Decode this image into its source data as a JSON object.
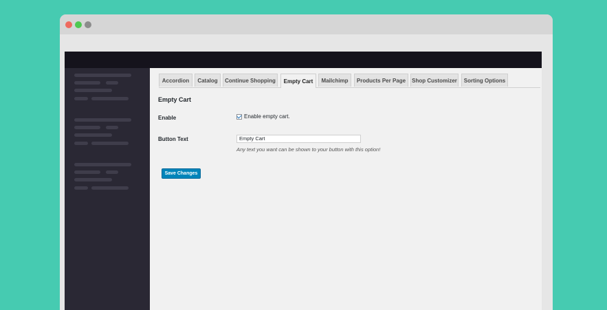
{
  "window": {
    "controls": [
      "close",
      "minimize",
      "maximize"
    ]
  },
  "tabs": [
    {
      "label": "Accordion",
      "active": false
    },
    {
      "label": "Catalog",
      "active": false
    },
    {
      "label": "Continue Shopping",
      "active": false
    },
    {
      "label": "Empty Cart",
      "active": true
    },
    {
      "label": "Mailchimp",
      "active": false
    },
    {
      "label": "Products Per Page",
      "active": false
    },
    {
      "label": "Shop Customizer",
      "active": false
    },
    {
      "label": "Sorting Options",
      "active": false
    }
  ],
  "section": {
    "title": "Empty Cart"
  },
  "enable": {
    "label": "Enable",
    "checkbox_label": "Enable empty cart.",
    "checked": true
  },
  "button_text": {
    "label": "Button Text",
    "value": "Empty Cart",
    "description": "Any text you want can be shown to your button with this option!"
  },
  "save": {
    "label": "Save Changes"
  },
  "colors": {
    "background": "#46cbb1",
    "admin_bar": "#15131c",
    "sidebar": "#2a2834",
    "primary_button": "#0085ba"
  }
}
